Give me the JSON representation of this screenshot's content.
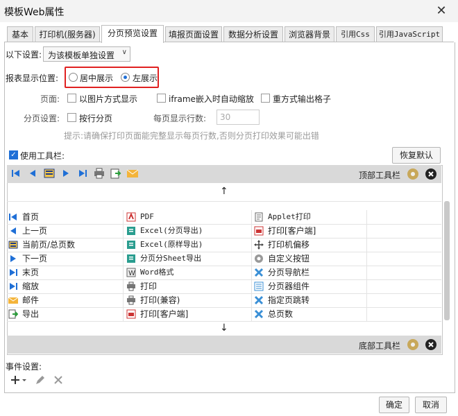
{
  "window": {
    "title": "模板Web属性",
    "close_label": "✕"
  },
  "tabs": [
    "基本",
    "打印机(服务器)",
    "分页预览设置",
    "填报页面设置",
    "数据分析设置",
    "浏览器背景",
    "引用Css",
    "引用JavaScript"
  ],
  "settings": {
    "scope_label": "以下设置:",
    "scope_value": "为该模板单独设置",
    "position_label": "报表显示位置:",
    "position_center": "居中展示",
    "position_left": "左展示",
    "page_label": "页面:",
    "opt_image": "以图片方式显示",
    "opt_iframe": "iframe嵌入时自动缩放",
    "opt_heavy": "重方式输出格子",
    "paging_label": "分页设置:",
    "opt_byrow": "按行分页",
    "rows_per_page_label": "每页显示行数:",
    "rows_per_page_placeholder": "30",
    "hint": "提示:请确保打印页面能完整显示每页行数,否则分页打印效果可能出错"
  },
  "toolbar": {
    "use_label": "使用工具栏:",
    "restore_label": "恢复默认",
    "top_label": "顶部工具栏",
    "bottom_label": "底部工具栏",
    "up_arrow": "↑",
    "down_arrow": "↓"
  },
  "items": {
    "col1": [
      "首页",
      "上一页",
      "当前页/总页数",
      "下一页",
      "末页",
      "缩放",
      "邮件",
      "导出"
    ],
    "col2": [
      "PDF",
      "Excel(分页导出)",
      "Excel(原样导出)",
      "分页分Sheet导出",
      "Word格式",
      "打印",
      "打印(兼容)",
      "打印[客户端]"
    ],
    "col3": [
      "Applet打印",
      "打印[客户端]",
      "打印机偏移",
      "自定义按钮",
      "分页导航栏",
      "分页器组件",
      "指定页跳转",
      "总页数"
    ]
  },
  "events": {
    "label": "事件设置:"
  },
  "footer": {
    "ok_label": "确定",
    "cancel_label": "取消"
  },
  "colors": {
    "accent": "#1f6fd6",
    "highlight": "#e02020"
  }
}
